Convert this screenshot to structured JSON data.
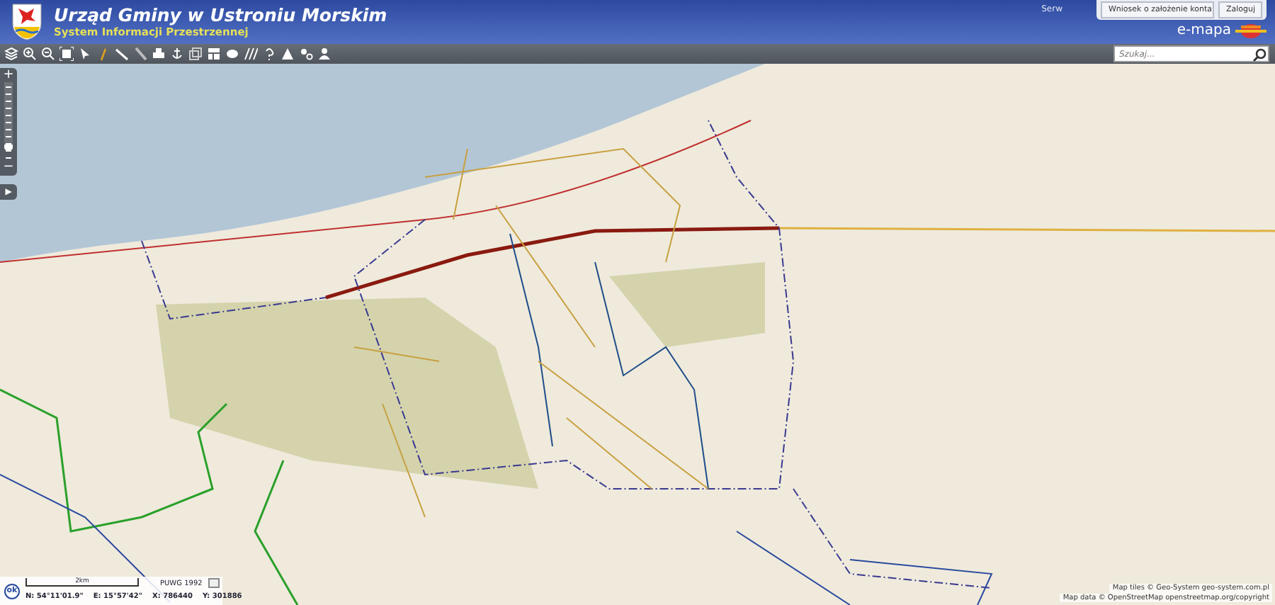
{
  "header": {
    "title": "Urząd Gminy w Ustroniu Morskim",
    "subtitle": "System Informacji Przestrzennej",
    "cut_label": "Serw",
    "buttons": [
      "Wniosek o założenie konta",
      "Zaloguj"
    ],
    "brand": "e-mapa"
  },
  "search": {
    "placeholder": "Szukaj..."
  },
  "zoom": {
    "plus": "+",
    "minus": "−",
    "level": 0.85,
    "panel_toggle": "▶"
  },
  "coordinates": {
    "ok": "ok",
    "scale": "2km",
    "system": "PUWG 1992",
    "n": "N: 54°11'01.9\"",
    "e": "E: 15°57'42\"",
    "x": "X: 786440",
    "y": "Y: 301886"
  },
  "attribution": [
    "Map tiles © Geo-System geo-system.com.pl",
    "Map data © OpenStreetMap openstreetmap.org/copyright"
  ]
}
